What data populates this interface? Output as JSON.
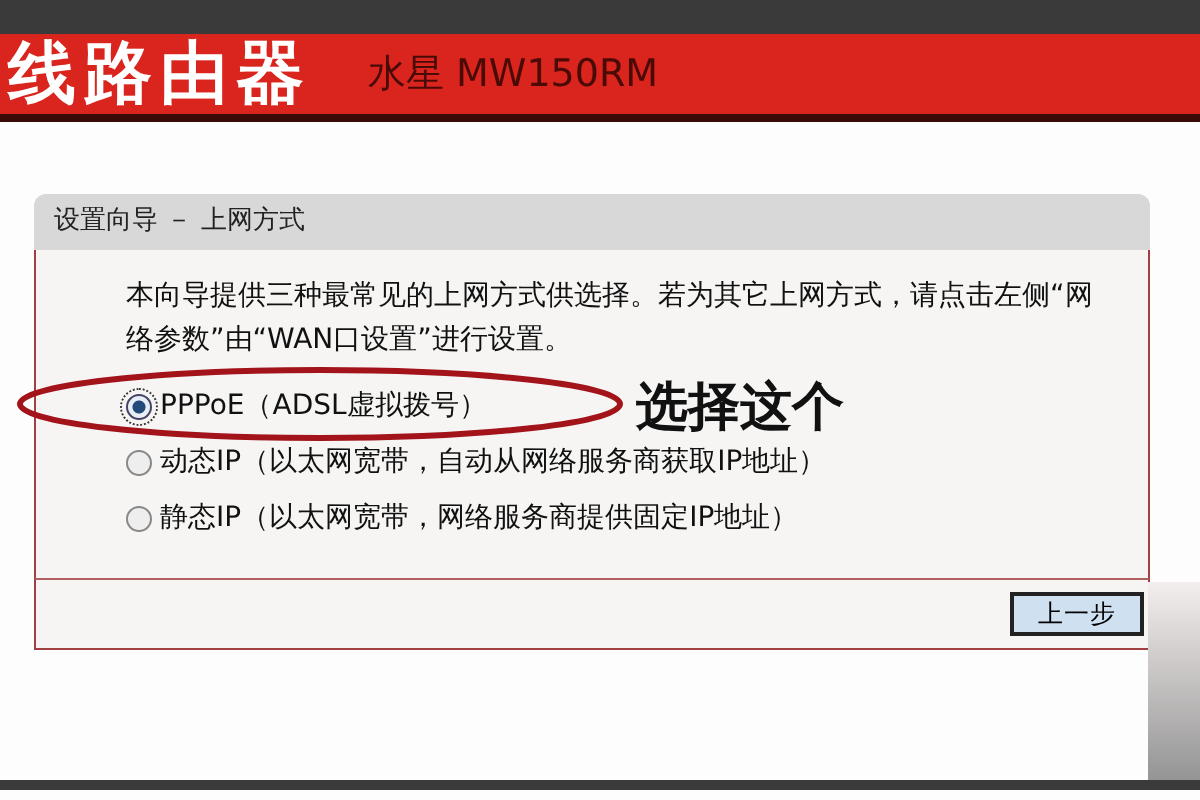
{
  "header": {
    "product": "线路由器",
    "model": "水星 MW150RM"
  },
  "panel": {
    "title": "设置向导 － 上网方式",
    "intro_lines": [
      "本向导提供三种最常见的上网方式供选择。若为其它上网方式，请点击左侧“网",
      "络参数”由“WAN口设置”进行设置。"
    ],
    "options": [
      {
        "label": "PPPoE（ADSL虚拟拨号）",
        "selected": true
      },
      {
        "label": "动态IP（以太网宽带，自动从网络服务商获取IP地址）",
        "selected": false
      },
      {
        "label": "静态IP（以太网宽带，网络服务商提供固定IP地址）",
        "selected": false
      }
    ],
    "buttons": [
      "上一步"
    ]
  },
  "annotation": {
    "text": "选择这个"
  }
}
